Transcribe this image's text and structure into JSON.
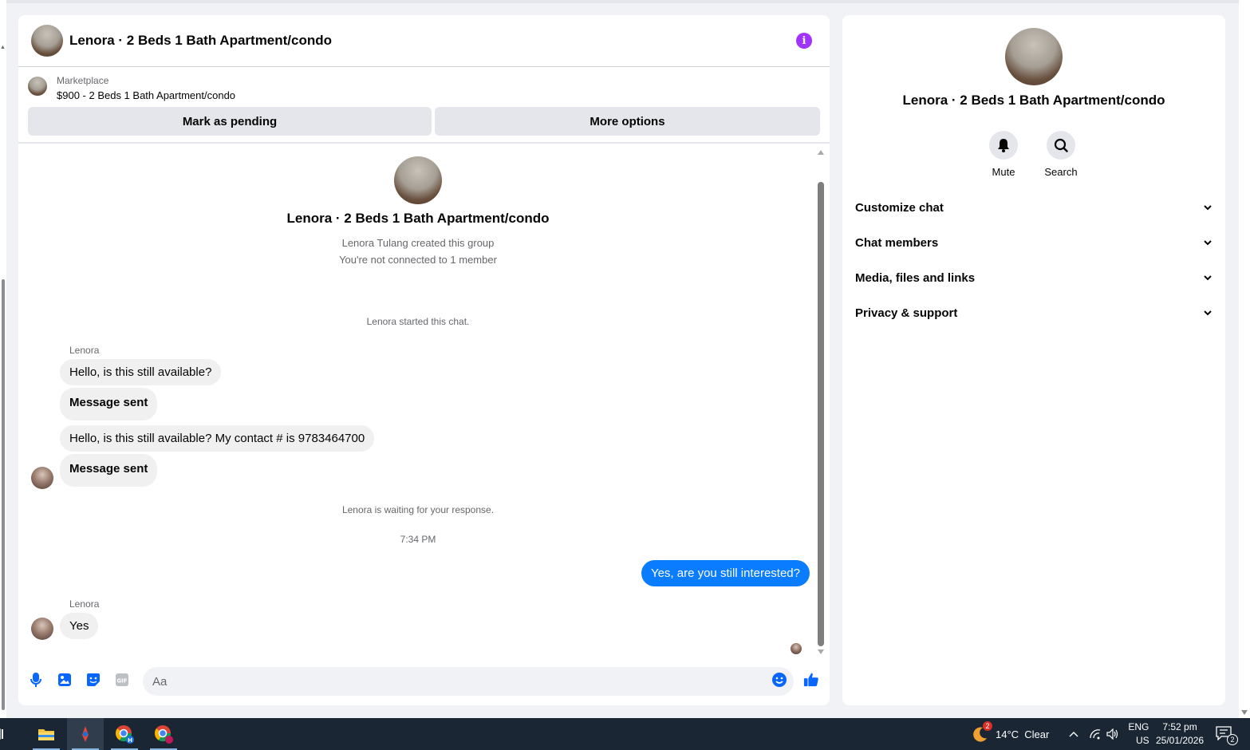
{
  "chat": {
    "title": "Lenora · 2 Beds 1 Bath Apartment/condo",
    "marketplace_label": "Marketplace",
    "listing": "$900 - 2 Beds 1 Bath Apartment/condo",
    "mark_pending_label": "Mark as pending",
    "more_options_label": "More options",
    "intro_title": "Lenora · 2 Beds 1 Bath Apartment/condo",
    "intro_created": "Lenora Tulang created this group",
    "intro_connected": "You're not connected to 1 member",
    "started": "Lenora started this chat.",
    "sender1": "Lenora",
    "msg1": "Hello, is this still available?",
    "msg2": "Message sent",
    "msg3": "Hello, is this still available? My contact # is 9783464700",
    "msg4": "Message sent",
    "waiting": "Lenora is waiting for your response.",
    "time": "7:34 PM",
    "msg_out": "Yes, are you still interested?",
    "sender2": "Lenora",
    "msg5": "Yes",
    "input_placeholder": "Aa"
  },
  "side": {
    "title": "Lenora · 2 Beds 1 Bath Apartment/condo",
    "mute_label": "Mute",
    "search_label": "Search",
    "rows": [
      "Customize chat",
      "Chat members",
      "Media, files and links",
      "Privacy & support"
    ]
  },
  "taskbar": {
    "weather": "14°C  Clear",
    "weather_badge": "2",
    "lang1": "ENG",
    "lang2": "US",
    "clock_time": "7:52 pm",
    "clock_date": "25/01/2026",
    "notif_count": "2"
  },
  "colors": {
    "accent_blue": "#0a7cff",
    "info_purple": "#a033ff",
    "icon_blue": "#0866ff"
  }
}
